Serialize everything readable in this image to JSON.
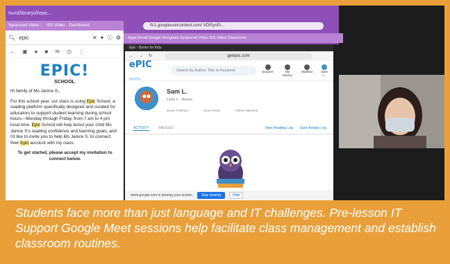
{
  "left_browser": {
    "tab_title": "Ivu/d/libraryof/epic...",
    "bookmarks": [
      "Syrassrod Video...",
      "ISS Video",
      "Dashboard"
    ],
    "find_text": "epic",
    "epic_logo": "EPIC!",
    "school_label": "SCHOOL",
    "greeting": "Hi family of Ms Janice S.,",
    "body_1a": "For this school year, our class is using ",
    "body_1b": " School, a reading platform specifically designed and curated for educators to support student learning during school hours—Monday through Friday, from 7 am to 4 pm local time. ",
    "body_1c": " School will help boost your child Ms Janice S's reading confidence and learning goals, and I'd like to invite you to help Ms Janice S. to connect their ",
    "body_1d": " account with my class.",
    "epic_word": "Epic",
    "cta": "To get started, please accept my invitation to connect below."
  },
  "middle_chrome": {
    "url": "lfc1.googleusercontent.com/ VDlSysEt...",
    "bookmarks": "Apps   Email   Google Hangouts   Syrassrod Video   ISS Video   Classroom"
  },
  "epic_window": {
    "tab": "Epic - Books for Kids",
    "address": "getepic.com",
    "logo": "ePIC",
    "logo_sub": "SCHOOL",
    "search_placeholder": "Search by Author, Title or Keyword",
    "nav": [
      "Explore",
      "My Library",
      "Mailbox",
      "Sam L."
    ],
    "profile_name": "Sam L.",
    "profile_level": "Level 1 – Novice",
    "stats": [
      "Books Finished",
      "Hours Read",
      "Videos Watched"
    ],
    "tab_activity": "ACTIVITY",
    "tab_badges": "BADGES",
    "view_reading_log": "View Reading Log",
    "save_activity_log": "Save Activity Log",
    "share_msg": "meet.google.com is sharing your screen.",
    "stop_sharing": "Stop sharing",
    "hide": "Hide"
  },
  "caption": "Students face more than just language and IT challenges. Pre-lesson IT Support Google Meet sessions help facilitate class management and establish classroom routines.",
  "colors": {
    "frame": "#e9a03b",
    "chrome_purple": "#8e4fb8",
    "epic_blue": "#1a7fc0"
  }
}
